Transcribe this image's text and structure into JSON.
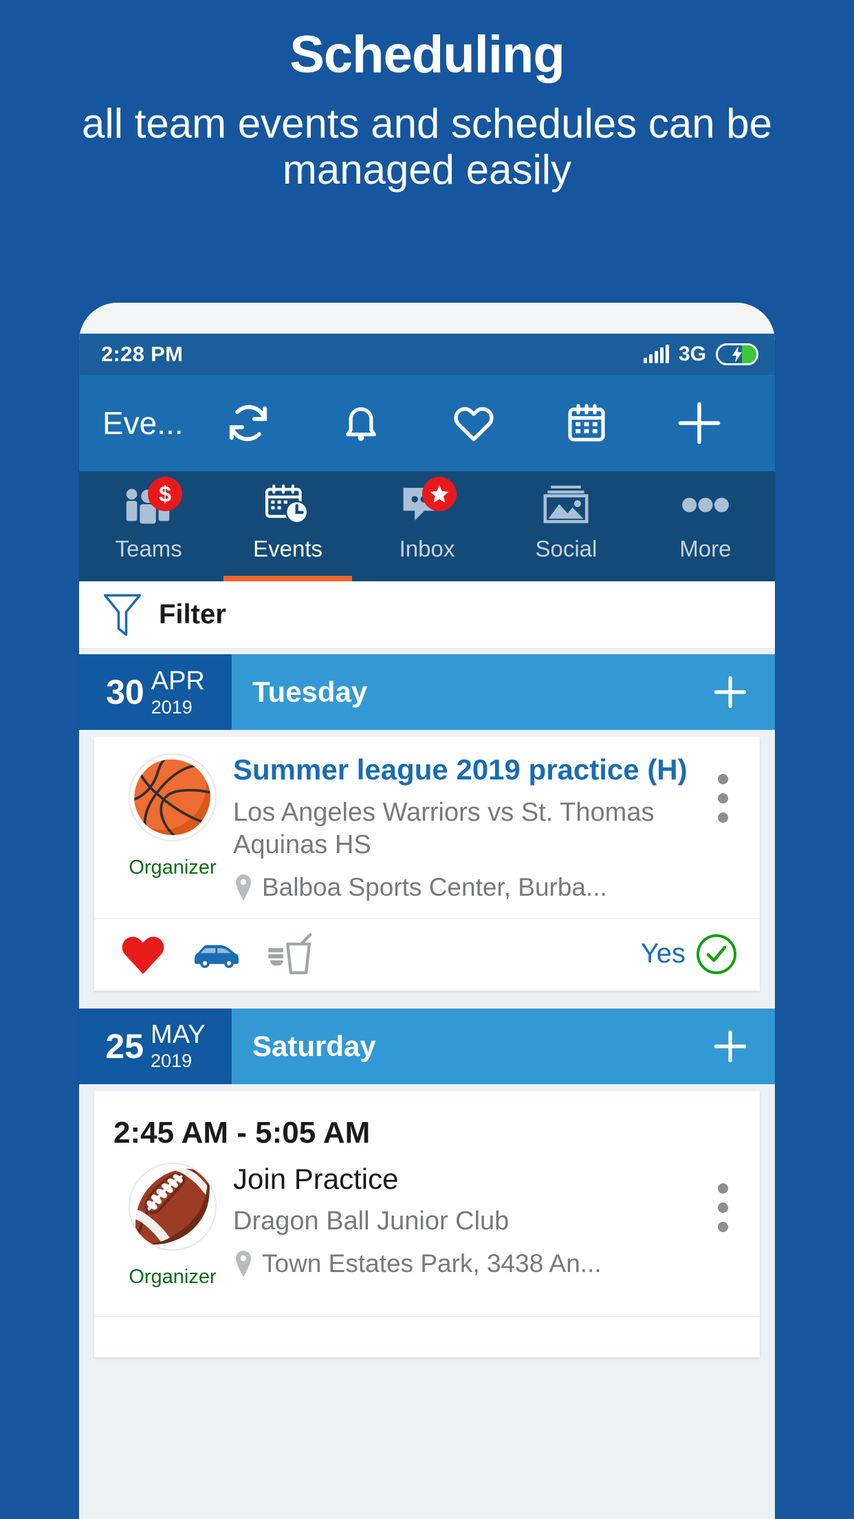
{
  "promo": {
    "title": "Scheduling",
    "subtitle": "all team events and schedules can be managed easily"
  },
  "colors": {
    "brand_blue": "#15569e",
    "appbar_blue": "#1c6cb0",
    "statusbar_blue": "#1a5e9c",
    "tabbar_blue": "#144a78",
    "accent_orange": "#f0662a",
    "badge_red": "#e8191b",
    "date_left_blue": "#1159a0",
    "date_right_blue": "#3399d4",
    "link_blue": "#1a6cb3",
    "organizer_green": "#0b6b19",
    "check_green": "#12a012",
    "heart_red": "#e81b1b",
    "car_blue": "#1a6cb3",
    "muted_gray": "#77797b"
  },
  "statusbar": {
    "time": "2:28 PM",
    "network": "3G",
    "signal_icon": "signal-bars-icon",
    "battery_icon": "battery-charging-icon"
  },
  "appbar": {
    "title": "Eve...",
    "actions": [
      {
        "name": "refresh-icon",
        "label": "Refresh"
      },
      {
        "name": "bell-icon",
        "label": "Notifications"
      },
      {
        "name": "heart-icon",
        "label": "Favorites"
      },
      {
        "name": "calendar-icon",
        "label": "Calendar"
      },
      {
        "name": "plus-icon",
        "label": "Add"
      }
    ]
  },
  "tabs": [
    {
      "label": "Teams",
      "icon": "people-icon",
      "badge": "$",
      "active": false
    },
    {
      "label": "Events",
      "icon": "calendar-clock-icon",
      "badge": "",
      "active": true
    },
    {
      "label": "Inbox",
      "icon": "chat-bubble-icon",
      "badge": "star",
      "active": false
    },
    {
      "label": "Social",
      "icon": "photo-icon",
      "badge": "",
      "active": false
    },
    {
      "label": "More",
      "icon": "ellipsis-icon",
      "badge": "",
      "active": false
    }
  ],
  "filter": {
    "label": "Filter",
    "icon": "funnel-icon"
  },
  "sections": [
    {
      "day": "30",
      "month": "APR",
      "year": "2019",
      "weekday": "Tuesday",
      "add_icon": "plus-icon",
      "event": {
        "avatar_emoji": "🏀",
        "avatar_name": "basketball-avatar",
        "organizer": "Organizer",
        "title": "Summer league 2019 practice (H)",
        "title_style": "link",
        "subtitle": "Los Angeles Warriors vs St. Thomas Aquinas HS",
        "location": "Balboa Sports Center, Burba...",
        "time": "",
        "actions": [
          {
            "name": "heart-filled-icon",
            "label": "Like"
          },
          {
            "name": "car-icon",
            "label": "Carpool"
          },
          {
            "name": "snack-drink-icon",
            "label": "Snacks"
          }
        ],
        "rsvp_label": "Yes",
        "rsvp_icon": "check-circle-icon",
        "menu_icon": "kebab-menu-icon"
      }
    },
    {
      "day": "25",
      "month": "MAY",
      "year": "2019",
      "weekday": "Saturday",
      "add_icon": "plus-icon",
      "event": {
        "avatar_emoji": "🏈",
        "avatar_name": "football-avatar",
        "organizer": "Organizer",
        "title": "Join Practice",
        "title_style": "plain",
        "subtitle": "Dragon Ball Junior Club",
        "location": "Town Estates Park, 3438 An...",
        "time": "2:45 AM - 5:05 AM",
        "actions": [],
        "rsvp_label": "",
        "rsvp_icon": "",
        "menu_icon": "kebab-menu-icon"
      }
    }
  ]
}
